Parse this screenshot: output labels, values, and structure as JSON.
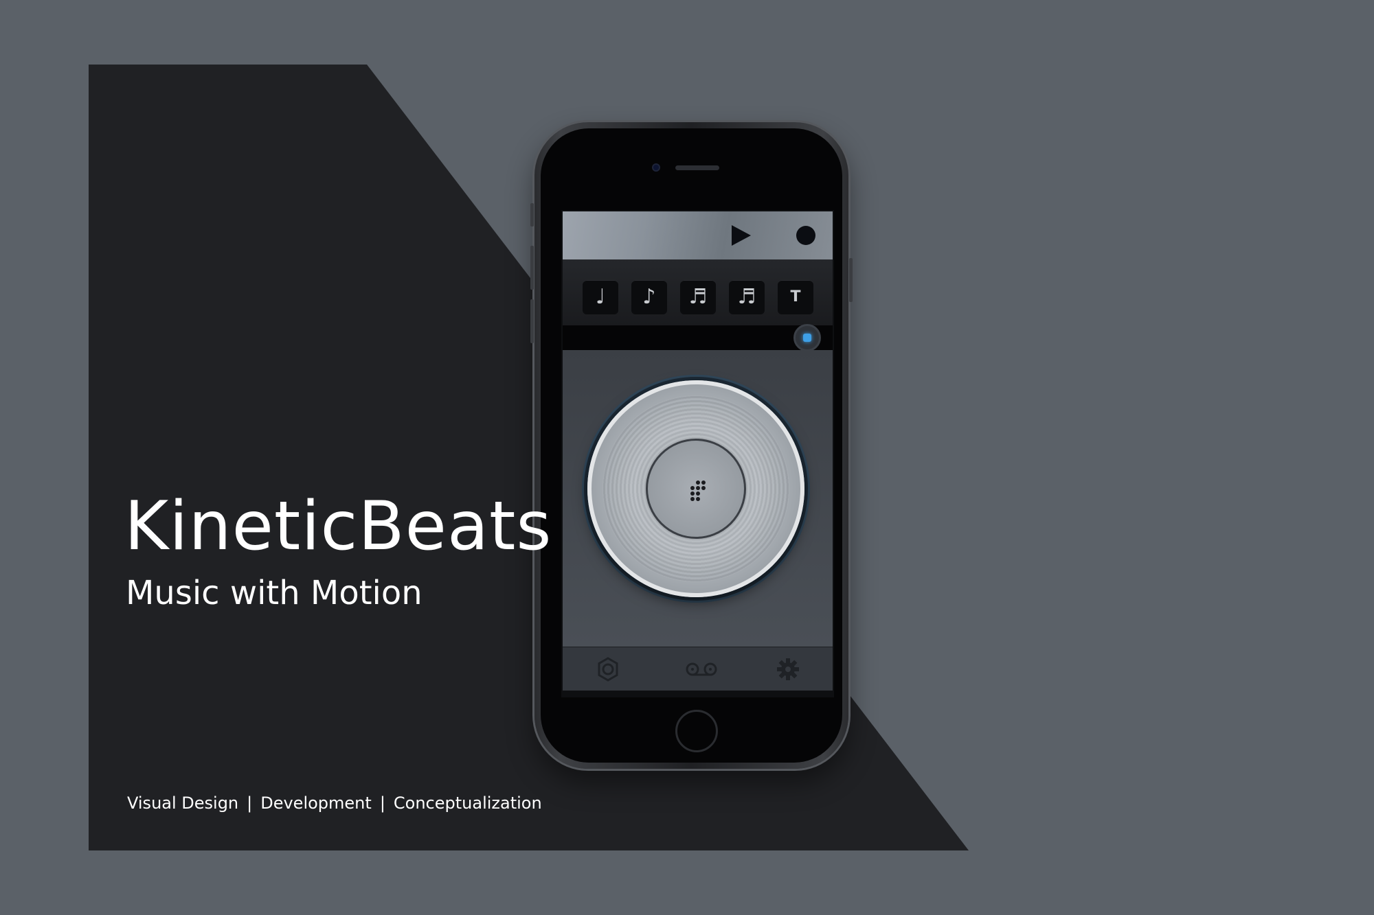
{
  "brand": {
    "title": "KineticBeats",
    "subtitle": "Music with Motion"
  },
  "credits": {
    "items": [
      "Visual Design",
      "Development",
      "Conceptualization"
    ],
    "separator": "|"
  },
  "colors": {
    "background": "#5b6168",
    "panel": "#202124",
    "text": "#ffffff",
    "accent": "#3e9fe6"
  },
  "app": {
    "transport": {
      "play_icon": "play-icon",
      "record_icon": "record-icon"
    },
    "note_buttons": [
      {
        "label": "♩",
        "name": "quarter-note"
      },
      {
        "label": "♪",
        "name": "eighth-note"
      },
      {
        "label": "♬",
        "name": "sixteenth-note"
      },
      {
        "label": "♬",
        "name": "thirty-second-note"
      },
      {
        "label": "T",
        "name": "triplet"
      }
    ],
    "bottom_nav": [
      {
        "icon": "speaker-icon"
      },
      {
        "icon": "tape-icon"
      },
      {
        "icon": "gear-icon"
      }
    ]
  }
}
